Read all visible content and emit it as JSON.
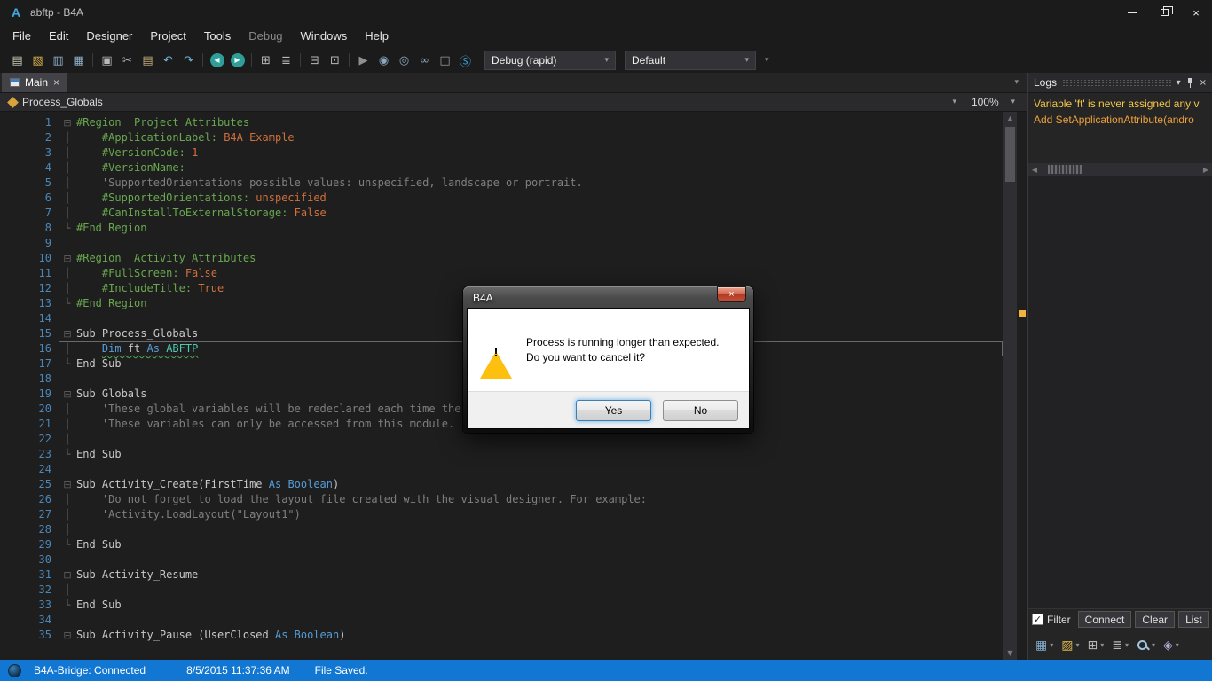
{
  "colors": {
    "c-pp": "#69a84f",
    "c-val": "#d0703c",
    "c-com": "#7f7f7f",
    "c-code": "#c8c8c8",
    "c-kw": "#569cd6",
    "c-type": "#4ec9b0",
    "c-linenum": "#4a87b8",
    "c-status": "#1177d2",
    "c-warnline": "#4fae58",
    "c-marker": "#f2b33c",
    "c-dialog-warn": "#fdc00f"
  },
  "window": {
    "logo": "A",
    "title": "abftp - B4A"
  },
  "menu": {
    "items": [
      {
        "label": "File"
      },
      {
        "label": "Edit"
      },
      {
        "label": "Designer"
      },
      {
        "label": "Project"
      },
      {
        "label": "Tools"
      },
      {
        "label": "Debug",
        "disabled": true
      },
      {
        "label": "Windows"
      },
      {
        "label": "Help"
      }
    ]
  },
  "toolbar": {
    "icons": [
      {
        "name": "new-file-icon",
        "glyph": "▤",
        "color": "#c9c9b4"
      },
      {
        "name": "open-project-icon",
        "glyph": "▧",
        "color": "#d9b44a"
      },
      {
        "name": "save-icon",
        "glyph": "▥",
        "color": "#8fb0c9"
      },
      {
        "name": "save-all-icon",
        "glyph": "▦",
        "color": "#8fb0c9"
      },
      {
        "sep": true
      },
      {
        "name": "copy-icon",
        "glyph": "▣",
        "color": "#b9b9b9"
      },
      {
        "name": "cut-icon",
        "glyph": "✂",
        "color": "#b9b9b9"
      },
      {
        "name": "paste-icon",
        "glyph": "▤",
        "color": "#c4ad7a"
      },
      {
        "name": "undo-icon",
        "glyph": "↶",
        "color": "#6fb3d2"
      },
      {
        "name": "redo-icon",
        "glyph": "↷",
        "color": "#6fb3d2"
      },
      {
        "sep": true
      },
      {
        "name": "navigate-back-icon",
        "glyph": "◀",
        "circle": true
      },
      {
        "name": "navigate-forward-icon",
        "glyph": "▶",
        "circle": true
      },
      {
        "sep": true
      },
      {
        "name": "designer-icon",
        "glyph": "⊞",
        "color": "#b9b9b9"
      },
      {
        "name": "designer-scripts-icon",
        "glyph": "≣",
        "color": "#b9b9b9"
      },
      {
        "sep": true
      },
      {
        "name": "add-module-icon",
        "glyph": "⊟",
        "color": "#b9b9b9"
      },
      {
        "name": "open-designer-icon",
        "glyph": "⊡",
        "color": "#b9b9b9"
      },
      {
        "sep": true
      },
      {
        "name": "run-icon",
        "glyph": "▶",
        "color": "#8f8f8f"
      },
      {
        "name": "compile-icon",
        "glyph": "◉",
        "color": "#8aa8c0"
      },
      {
        "name": "bridge-connect-icon",
        "glyph": "◎",
        "color": "#8aa8c0"
      },
      {
        "name": "link-icon",
        "glyph": "∞",
        "color": "#8aa8c0"
      },
      {
        "name": "stop-icon",
        "glyph": "□",
        "color": "#9a9a9a"
      },
      {
        "name": "libraries-icon",
        "glyph": "Ⓢ",
        "color": "#3e9ed6"
      }
    ],
    "build_config": "Debug (rapid)",
    "default_config": "Default",
    "overflow_arrow": "▾"
  },
  "tabs": [
    {
      "label": "Main",
      "close": "×"
    }
  ],
  "code_nav": {
    "selected": "Process_Globals",
    "zoom": "100%",
    "arrow": "▾"
  },
  "editor": {
    "lines": [
      {
        "n": 1,
        "fold": "start",
        "tokens": [
          [
            "#Region  Project Attributes",
            "pp"
          ]
        ]
      },
      {
        "n": 2,
        "fold": "mid",
        "tokens": [
          [
            "    ",
            "code"
          ],
          [
            "#ApplicationLabel: ",
            "pp"
          ],
          [
            "B4A Example",
            "val"
          ]
        ]
      },
      {
        "n": 3,
        "fold": "mid",
        "tokens": [
          [
            "    ",
            "code"
          ],
          [
            "#VersionCode: ",
            "pp"
          ],
          [
            "1",
            "val"
          ]
        ]
      },
      {
        "n": 4,
        "fold": "mid",
        "tokens": [
          [
            "    ",
            "code"
          ],
          [
            "#VersionName: ",
            "pp"
          ]
        ]
      },
      {
        "n": 5,
        "fold": "mid",
        "tokens": [
          [
            "    ",
            "code"
          ],
          [
            "'SupportedOrientations possible values: unspecified, landscape or portrait.",
            "com"
          ]
        ]
      },
      {
        "n": 6,
        "fold": "mid",
        "tokens": [
          [
            "    ",
            "code"
          ],
          [
            "#SupportedOrientations: ",
            "pp"
          ],
          [
            "unspecified",
            "val"
          ]
        ]
      },
      {
        "n": 7,
        "fold": "mid",
        "tokens": [
          [
            "    ",
            "code"
          ],
          [
            "#CanInstallToExternalStorage: ",
            "pp"
          ],
          [
            "False",
            "val"
          ]
        ]
      },
      {
        "n": 8,
        "fold": "end",
        "tokens": [
          [
            "#End Region",
            "pp"
          ]
        ]
      },
      {
        "n": 9,
        "fold": "",
        "tokens": []
      },
      {
        "n": 10,
        "fold": "start",
        "tokens": [
          [
            "#Region  Activity Attributes",
            "pp"
          ]
        ]
      },
      {
        "n": 11,
        "fold": "mid",
        "tokens": [
          [
            "    ",
            "code"
          ],
          [
            "#FullScreen: ",
            "pp"
          ],
          [
            "False",
            "val"
          ]
        ]
      },
      {
        "n": 12,
        "fold": "mid",
        "tokens": [
          [
            "    ",
            "code"
          ],
          [
            "#IncludeTitle: ",
            "pp"
          ],
          [
            "True",
            "val"
          ]
        ]
      },
      {
        "n": 13,
        "fold": "end",
        "tokens": [
          [
            "#End Region",
            "pp"
          ]
        ]
      },
      {
        "n": 14,
        "fold": "",
        "tokens": []
      },
      {
        "n": 15,
        "fold": "start",
        "tokens": [
          [
            "Sub Process_Globals",
            "code"
          ]
        ]
      },
      {
        "n": 16,
        "fold": "mid",
        "current": true,
        "tokens": [
          [
            "    ",
            "code"
          ],
          [
            "Dim ",
            "kw warn"
          ],
          [
            "ft ",
            "code warn"
          ],
          [
            "As ",
            "kw warn"
          ],
          [
            "ABFTP",
            "type warn"
          ]
        ]
      },
      {
        "n": 17,
        "fold": "end",
        "tokens": [
          [
            "End Sub",
            "code"
          ]
        ]
      },
      {
        "n": 18,
        "fold": "",
        "tokens": []
      },
      {
        "n": 19,
        "fold": "start",
        "tokens": [
          [
            "Sub Globals",
            "code"
          ]
        ]
      },
      {
        "n": 20,
        "fold": "mid",
        "tokens": [
          [
            "    ",
            "code"
          ],
          [
            "'These global variables will be redeclared each time the activity is created.",
            "com"
          ]
        ]
      },
      {
        "n": 21,
        "fold": "mid",
        "tokens": [
          [
            "    ",
            "code"
          ],
          [
            "'These variables can only be accessed from this module.",
            "com"
          ]
        ]
      },
      {
        "n": 22,
        "fold": "mid",
        "tokens": []
      },
      {
        "n": 23,
        "fold": "end",
        "tokens": [
          [
            "End Sub",
            "code"
          ]
        ]
      },
      {
        "n": 24,
        "fold": "",
        "tokens": []
      },
      {
        "n": 25,
        "fold": "start",
        "tokens": [
          [
            "Sub Activity_Create(FirstTime ",
            "code"
          ],
          [
            "As ",
            "kw"
          ],
          [
            "Boolean",
            "kw"
          ],
          [
            ")",
            "code"
          ]
        ]
      },
      {
        "n": 26,
        "fold": "mid",
        "tokens": [
          [
            "    ",
            "code"
          ],
          [
            "'Do not forget to load the layout file created with the visual designer. For example:",
            "com"
          ]
        ]
      },
      {
        "n": 27,
        "fold": "mid",
        "tokens": [
          [
            "    ",
            "code"
          ],
          [
            "'Activity.LoadLayout(\"Layout1\")",
            "com"
          ]
        ]
      },
      {
        "n": 28,
        "fold": "mid",
        "tokens": []
      },
      {
        "n": 29,
        "fold": "end",
        "tokens": [
          [
            "End Sub",
            "code"
          ]
        ]
      },
      {
        "n": 30,
        "fold": "",
        "tokens": []
      },
      {
        "n": 31,
        "fold": "start",
        "tokens": [
          [
            "Sub Activity_Resume",
            "code"
          ]
        ]
      },
      {
        "n": 32,
        "fold": "mid",
        "tokens": []
      },
      {
        "n": 33,
        "fold": "end",
        "tokens": [
          [
            "End Sub",
            "code"
          ]
        ]
      },
      {
        "n": 34,
        "fold": "",
        "tokens": []
      },
      {
        "n": 35,
        "fold": "start",
        "tokens": [
          [
            "Sub Activity_Pause (UserClosed ",
            "code"
          ],
          [
            "As ",
            "kw"
          ],
          [
            "Boolean",
            "kw"
          ],
          [
            ")",
            "code"
          ]
        ]
      }
    ]
  },
  "logs": {
    "title": "Logs",
    "messages": [
      {
        "text": "Variable 'ft' is never assigned any v",
        "color": "#f2c648"
      },
      {
        "text": "Add SetApplicationAttribute(andro",
        "color": "#eda03b"
      }
    ],
    "filter": {
      "label": "Filter",
      "checked": true,
      "check_glyph": "✓"
    },
    "buttons": [
      "Connect",
      "Clear",
      "List"
    ]
  },
  "panel_bar": {
    "icons": [
      {
        "name": "panels-icon",
        "glyph": "▦",
        "color": "#7fa7c8",
        "dd": true
      },
      {
        "name": "files-icon",
        "glyph": "▨",
        "color": "#d9b44a",
        "dd": true
      },
      {
        "name": "views-icon",
        "glyph": "⊞",
        "color": "#b9b9b9",
        "dd": true
      },
      {
        "name": "modules-list-icon",
        "glyph": "≣",
        "color": "#b9b9b9",
        "dd": true
      },
      {
        "name": "search-icon",
        "css": "mag",
        "dd": true
      },
      {
        "name": "libraries-manager-icon",
        "glyph": "◈",
        "color": "#b9a8d0",
        "dd": true
      }
    ]
  },
  "status": {
    "bridge": "B4A-Bridge: Connected",
    "time": "8/5/2015 11:37:36 AM",
    "saved": "File Saved."
  },
  "dialog": {
    "title": "B4A",
    "lines": [
      "Process is running longer than expected.",
      "Do you want to cancel it?"
    ],
    "warning_glyph": "!",
    "yes": "Yes",
    "no": "No"
  }
}
